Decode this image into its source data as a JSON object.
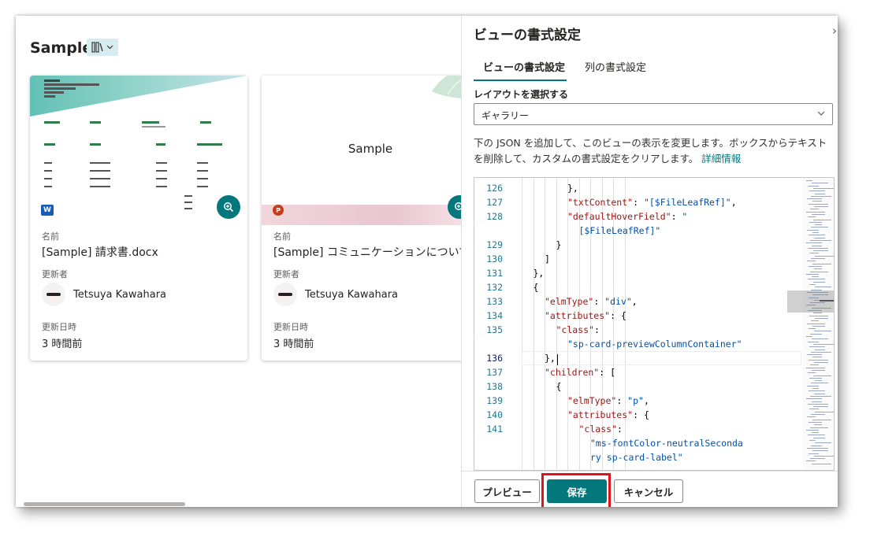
{
  "library": {
    "title": "Sample",
    "view_icon": "gallery-view-icon"
  },
  "cards": [
    {
      "file_type": "word",
      "name_label": "名前",
      "name": "[Sample] 請求書.docx",
      "modified_by_label": "更新者",
      "modified_by": "Tetsuya Kawahara",
      "modified_label": "更新日時",
      "modified": "3 時間前"
    },
    {
      "file_type": "powerpoint",
      "slide_title": "Sample",
      "name_label": "名前",
      "name": "[Sample] コミュニケーションについて.pptx",
      "modified_by_label": "更新者",
      "modified_by": "Tetsuya Kawahara",
      "modified_label": "更新日時",
      "modified": "3 時間前"
    }
  ],
  "panel": {
    "title": "ビューの書式設定",
    "tabs": [
      {
        "label": "ビューの書式設定",
        "active": true
      },
      {
        "label": "列の書式設定",
        "active": false
      }
    ],
    "layout_label": "レイアウトを選択する",
    "layout_value": "ギャラリー",
    "description": "下の JSON を追加して、このビューの表示を変更します。ボックスからテキストを削除して、カスタムの書式設定をクリアします。",
    "more_info": "詳細情報",
    "code": {
      "active_line": "136",
      "lines": [
        {
          "no": "126",
          "text": "},",
          "indent": 8
        },
        {
          "no": "127",
          "text": "\"txtContent\": \"[$FileLeafRef]\",",
          "indent": 8
        },
        {
          "no": "128",
          "text": "\"defaultHoverField\": \"",
          "indent": 8
        },
        {
          "no": "",
          "text": "[$FileLeafRef]\"",
          "indent": 9
        },
        {
          "no": "129",
          "text": "}",
          "indent": 7
        },
        {
          "no": "130",
          "text": "]",
          "indent": 6
        },
        {
          "no": "131",
          "text": "},",
          "indent": 5
        },
        {
          "no": "132",
          "text": "{",
          "indent": 5
        },
        {
          "no": "133",
          "text": "\"elmType\": \"div\",",
          "indent": 6
        },
        {
          "no": "134",
          "text": "\"attributes\": {",
          "indent": 6
        },
        {
          "no": "135",
          "text": "\"class\":",
          "indent": 7
        },
        {
          "no": "",
          "text": "\"sp-card-previewColumnContainer\"",
          "indent": 8
        },
        {
          "no": "136",
          "text": "},",
          "indent": 6
        },
        {
          "no": "137",
          "text": "\"children\": [",
          "indent": 6
        },
        {
          "no": "138",
          "text": "{",
          "indent": 7
        },
        {
          "no": "139",
          "text": "\"elmType\": \"p\",",
          "indent": 8
        },
        {
          "no": "140",
          "text": "\"attributes\": {",
          "indent": 8
        },
        {
          "no": "141",
          "text": "\"class\":",
          "indent": 9
        },
        {
          "no": "",
          "text": "\"ms-fontColor-neutralSeconda",
          "indent": 10
        },
        {
          "no": "",
          "text": "ry sp-card-label\"",
          "indent": 10
        }
      ]
    },
    "buttons": {
      "preview": "プレビュー",
      "save": "保存",
      "cancel": "キャンセル"
    }
  },
  "colors": {
    "accent": "#03787c",
    "highlight": "#e0131b"
  }
}
